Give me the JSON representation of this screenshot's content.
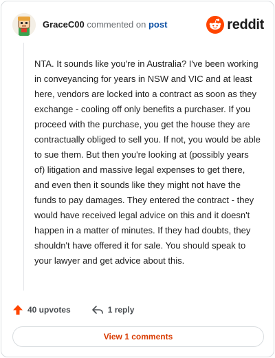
{
  "comment": {
    "username": "GraceC00",
    "commented_text": "commented on",
    "post_link": "post",
    "body": "NTA. It sounds like you're in Australia? I've been working in conveyancing for years in NSW and VIC and at least here, vendors are locked into a contract as soon as they exchange - cooling off only benefits a purchaser. If you proceed with the purchase, you get the house they are contractually obliged to sell you. If not, you would be able to sue them. But then you're looking at (possibly years of) litigation and massive legal expenses to get there, and even then it sounds like they might not have the funds to pay damages. They entered the contract - they would have received legal advice on this and it doesn't happen in a matter of minutes. If they had doubts, they shouldn't have offered it for sale. You should speak to your lawyer and get advice about this.",
    "upvotes_label": "40 upvotes",
    "reply_label": "1 reply",
    "view_comments_label": "View 1 comments"
  },
  "brand": {
    "name": "reddit",
    "color": "#ff4500"
  },
  "icons": {
    "avatar": "snoo-avatar",
    "brand_logo": "reddit-logo-icon",
    "upvote": "upvote-arrow-icon",
    "reply": "reply-arrow-icon"
  },
  "colors": {
    "accent": "#d93a00",
    "upvote": "#ff4500",
    "link": "#0a4ea3"
  }
}
